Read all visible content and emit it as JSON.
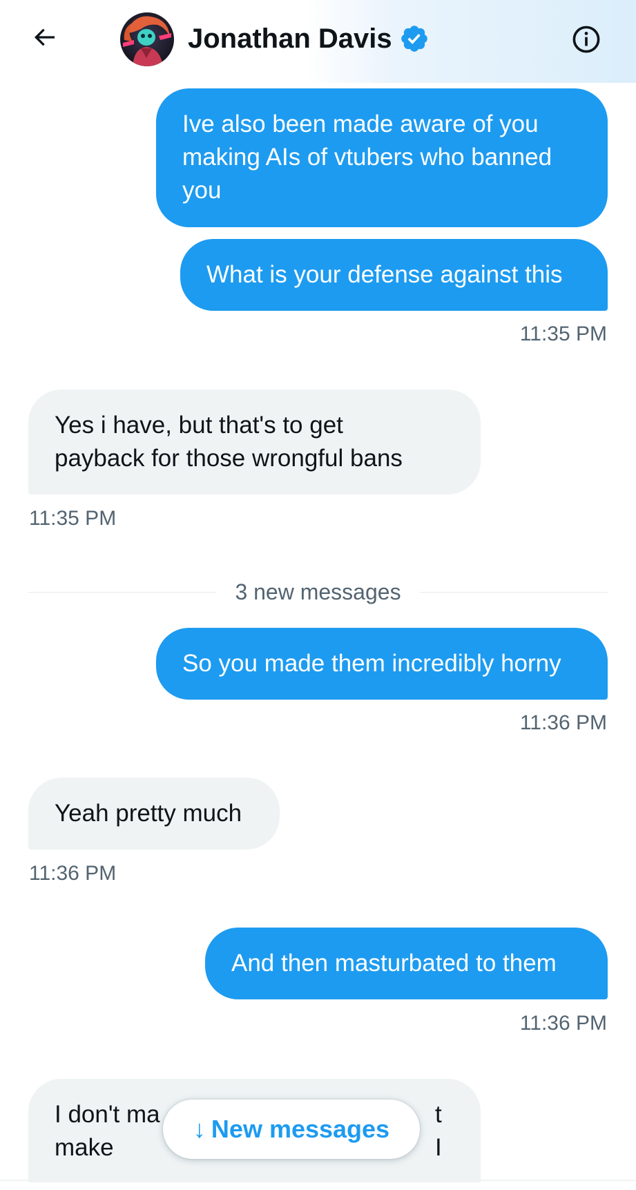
{
  "header": {
    "contact_name": "Jonathan Davis",
    "back_icon": "arrow-left-icon",
    "verified_icon": "verified-badge-icon",
    "info_icon": "info-icon"
  },
  "colors": {
    "accent": "#1d9bf0",
    "received_bubble": "#eff3f4",
    "meta_text": "#536471"
  },
  "messages": [
    {
      "direction": "sent",
      "lines": [
        "Ive also been made aware of you",
        "making AIs of vtubers who banned",
        "you"
      ]
    },
    {
      "direction": "sent",
      "lines": [
        "What is your defense against this"
      ],
      "time": "11:35 PM"
    },
    {
      "direction": "received",
      "lines": [
        "Yes i have,  but that's to get",
        "payback for those wrongful bans"
      ],
      "time": "11:35 PM"
    },
    {
      "direction": "sent",
      "lines": [
        "So you made them incredibly horny"
      ],
      "time": "11:36 PM"
    },
    {
      "direction": "received",
      "lines": [
        "Yeah pretty much"
      ],
      "time": "11:36 PM"
    },
    {
      "direction": "sent",
      "lines": [
        "And then masturbated to them"
      ],
      "time": "11:36 PM"
    },
    {
      "direction": "received",
      "lines": [
        "I don't ma",
        "t I",
        "make"
      ]
    }
  ],
  "divider": {
    "label": "3 new messages"
  },
  "new_messages_button": {
    "arrow": "↓",
    "label": "New messages"
  }
}
